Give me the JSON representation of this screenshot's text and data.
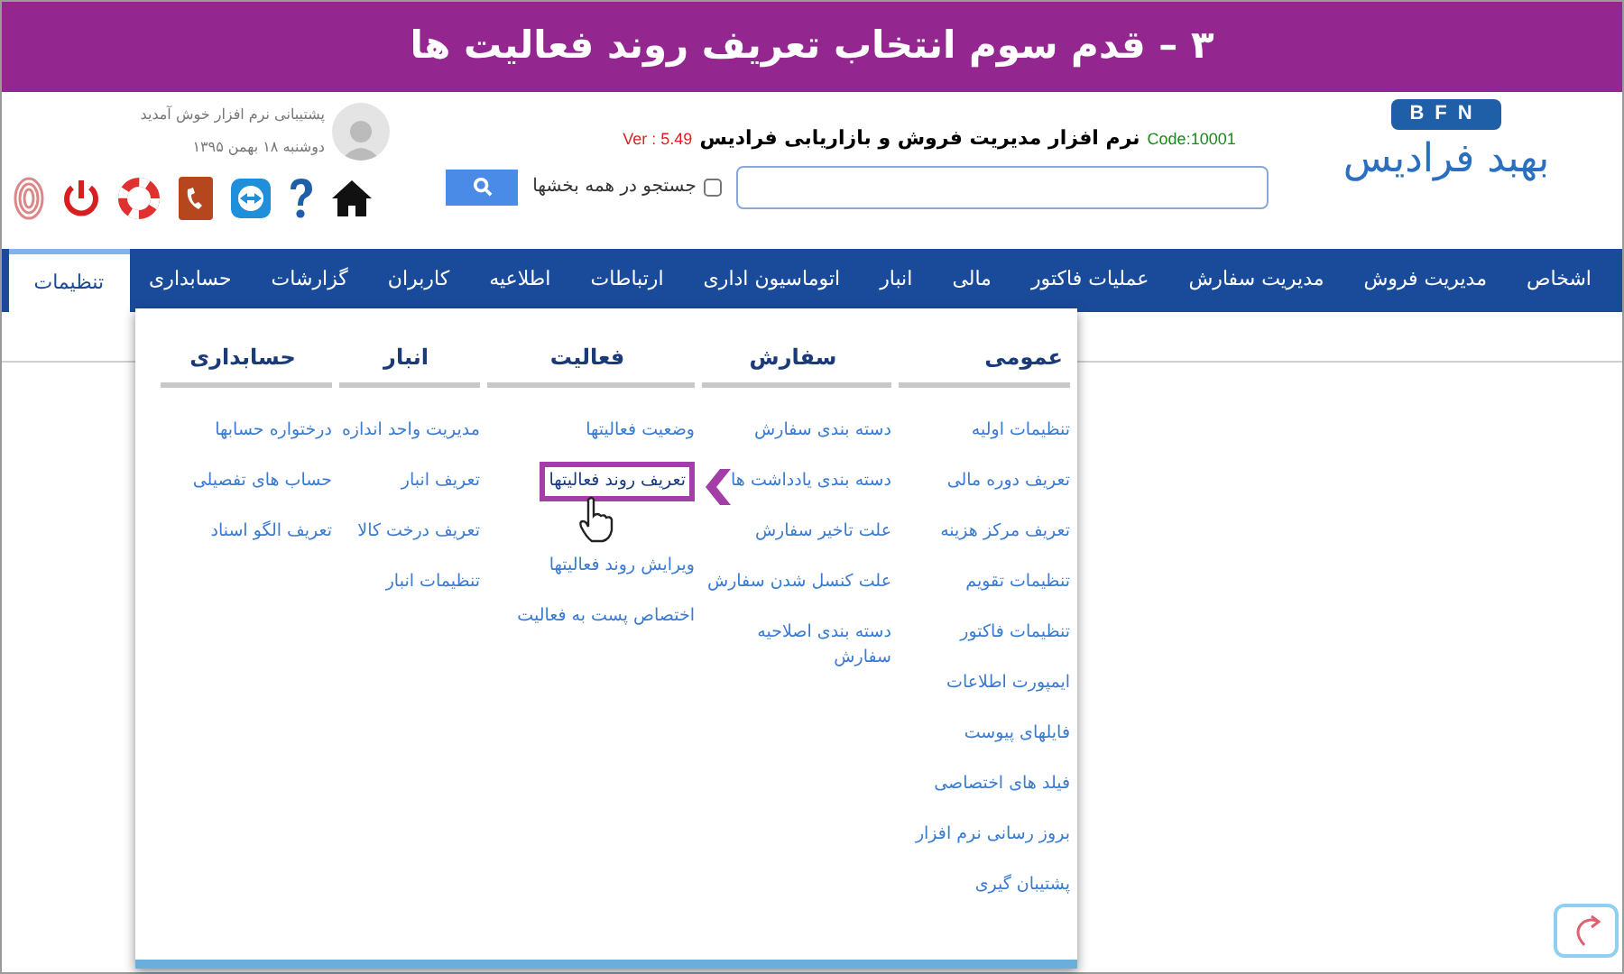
{
  "banner": {
    "title": "۳ – قدم سوم انتخاب تعریف روند فعالیت ها"
  },
  "header": {
    "logo_mark": "BFN",
    "logo_name": "بهبد فرادیس",
    "code": "Code:10001",
    "product_title": "نرم افزار مدیریت فروش و بازاریابی فرادیس",
    "version": "Ver : 5.49",
    "search": {
      "all_sections_label": "جستجو در همه بخشها",
      "all_sections_checked": false
    },
    "welcome": "پشتیبانی نرم افزار خوش آمدید",
    "date": "دوشنبه ۱۸ بهمن ۱۳۹۵"
  },
  "nav": [
    {
      "label": "اشخاص",
      "selected": false
    },
    {
      "label": "مدیریت فروش",
      "selected": false
    },
    {
      "label": "مدیریت سفارش",
      "selected": false
    },
    {
      "label": "عملیات فاکتور",
      "selected": false
    },
    {
      "label": "مالی",
      "selected": false
    },
    {
      "label": "انبار",
      "selected": false
    },
    {
      "label": "اتوماسیون اداری",
      "selected": false
    },
    {
      "label": "ارتباطات",
      "selected": false
    },
    {
      "label": "اطلاعیه",
      "selected": false
    },
    {
      "label": "کاربران",
      "selected": false
    },
    {
      "label": "گزارشات",
      "selected": false
    },
    {
      "label": "حسابداری",
      "selected": false
    },
    {
      "label": "تنظیمات",
      "selected": true
    }
  ],
  "menu": {
    "columns": [
      {
        "title": "عمومی",
        "items": [
          {
            "label": "تنظیمات اولیه",
            "selected": false
          },
          {
            "label": "تعریف دوره مالی",
            "selected": false
          },
          {
            "label": "تعریف مرکز هزینه",
            "selected": false
          },
          {
            "label": "تنظیمات تقویم",
            "selected": false
          },
          {
            "label": "تنظیمات فاکتور",
            "selected": false
          },
          {
            "label": "ایمپورت اطلاعات",
            "selected": false
          },
          {
            "label": "فایلهای پیوست",
            "selected": false
          },
          {
            "label": "فیلد های اختصاصی",
            "selected": false
          },
          {
            "label": "بروز رسانی نرم افزار",
            "selected": false
          },
          {
            "label": "پشتیبان گیری",
            "selected": false
          }
        ]
      },
      {
        "title": "سفارش",
        "items": [
          {
            "label": "دسته بندی سفارش",
            "selected": false
          },
          {
            "label": "دسته بندی یادداشت ها",
            "selected": false
          },
          {
            "label": "علت تاخیر سفارش",
            "selected": false
          },
          {
            "label": "علت کنسل شدن سفارش",
            "selected": false
          },
          {
            "label": "دسته بندی اصلاحیه سفارش",
            "selected": false
          }
        ]
      },
      {
        "title": "فعالیت",
        "items": [
          {
            "label": "وضعیت فعالیتها",
            "selected": false
          },
          {
            "label": "تعریف روند فعالیتها",
            "selected": true
          },
          {
            "label": "ویرایش روند فعالیتها",
            "selected": false
          },
          {
            "label": "اختصاص پست به فعالیت",
            "selected": false
          }
        ]
      },
      {
        "title": "انبار",
        "items": [
          {
            "label": "مدیریت واحد اندازه",
            "selected": false
          },
          {
            "label": "تعریف انبار",
            "selected": false
          },
          {
            "label": "تعریف درخت کالا",
            "selected": false
          },
          {
            "label": "تنظیمات انبار",
            "selected": false
          }
        ]
      },
      {
        "title": "حسابداری",
        "items": [
          {
            "label": "درختواره حسابها",
            "selected": false
          },
          {
            "label": "حساب های تفصیلی",
            "selected": false
          },
          {
            "label": "تعریف الگو اسناد",
            "selected": false
          }
        ]
      }
    ]
  }
}
